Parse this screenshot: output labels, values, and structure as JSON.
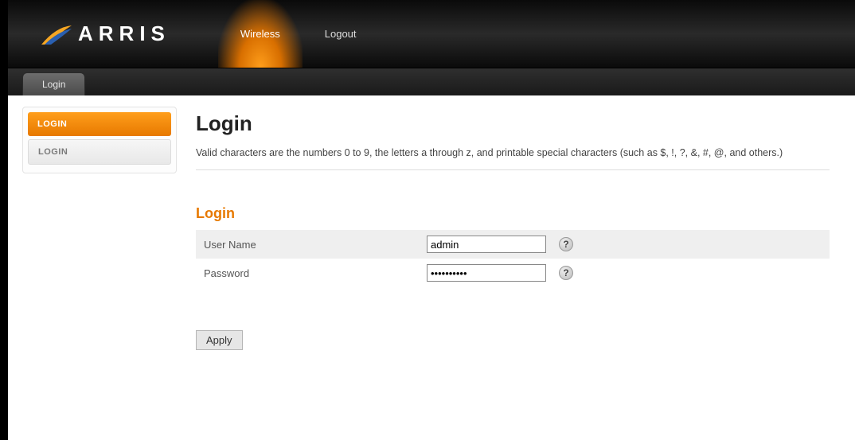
{
  "brand": {
    "name": "ARRIS"
  },
  "nav": {
    "items": [
      {
        "label": "Wireless",
        "active": true
      },
      {
        "label": "Logout",
        "active": false
      }
    ]
  },
  "subnav": {
    "tab": "Login"
  },
  "sidebar": {
    "items": [
      {
        "label": "LOGIN",
        "active": true
      },
      {
        "label": "LOGIN",
        "active": false
      }
    ]
  },
  "page": {
    "title": "Login",
    "description": "Valid characters are the numbers 0 to 9, the letters a through z, and printable special characters (such as $, !, ?, &, #, @, and others.)"
  },
  "form": {
    "section_title": "Login",
    "username_label": "User Name",
    "password_label": "Password",
    "username_value": "admin",
    "password_value": "••••••••••",
    "help_glyph": "?",
    "apply_label": "Apply"
  }
}
